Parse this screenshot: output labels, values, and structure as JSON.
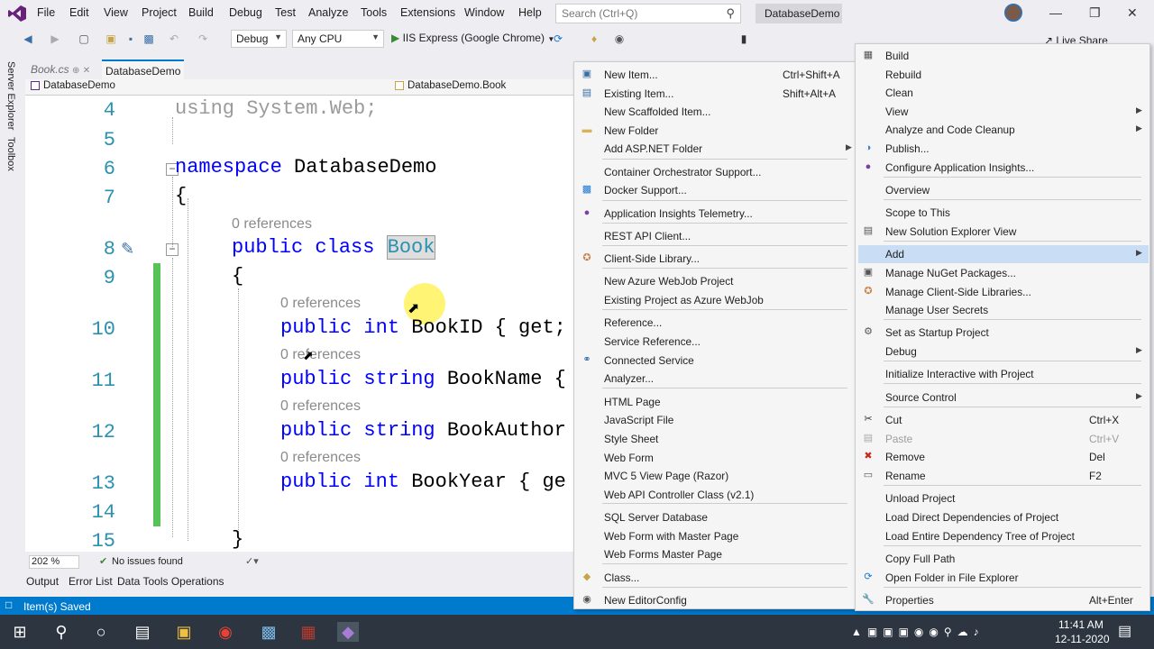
{
  "menubar": {
    "items": [
      "File",
      "Edit",
      "View",
      "Project",
      "Build",
      "Debug",
      "Test",
      "Analyze",
      "Tools",
      "Extensions",
      "Window",
      "Help"
    ],
    "search_placeholder": "Search (Ctrl+Q)",
    "solution_title": "DatabaseDemo"
  },
  "toolbar": {
    "config": "Debug",
    "platform": "Any CPU",
    "run": "IIS Express (Google Chrome)",
    "live_share": "Live Share"
  },
  "leftstrip": {
    "server_explorer": "Server Explorer",
    "toolbox": "Toolbox"
  },
  "tabs": [
    "Book.cs",
    "DatabaseDemo"
  ],
  "nav": {
    "project": "DatabaseDemo",
    "class": "DatabaseDemo.Book"
  },
  "code": {
    "l4": "4",
    "l5": "5",
    "l6": "6",
    "l7": "7",
    "l8": "8",
    "l9": "9",
    "l10": "10",
    "l11": "11",
    "l12": "12",
    "l13": "13",
    "l14": "14",
    "l15": "15",
    "using_kw": "using",
    "using_ns": "System.Web;",
    "ns_kw": "namespace",
    "ns_name": "DatabaseDemo",
    "open_brace": "{",
    "close_brace": "}",
    "refs": "0 references",
    "class_kw": "public class",
    "class_name": "Book",
    "p1_kw": "public int",
    "p1_rest": "BookID { get;",
    "p2_kw": "public string",
    "p2_rest": "BookName {",
    "p3_kw": "public string",
    "p3_rest": "BookAuthor",
    "p4_kw": "public int",
    "p4_rest": "BookYear { ge"
  },
  "editor_status": {
    "zoom": "202 %",
    "issues": "No issues found"
  },
  "bottom_tabs": [
    "Output",
    "Error List",
    "Data Tools Operations"
  ],
  "statusbar": {
    "text": "Item(s) Saved"
  },
  "taskbar": {
    "time": "11:41 AM",
    "date": "12-11-2020"
  },
  "add_menu": [
    {
      "label": "New Item...",
      "shortcut": "Ctrl+Shift+A",
      "icon": "new-item-icon"
    },
    {
      "label": "Existing Item...",
      "shortcut": "Shift+Alt+A",
      "icon": "existing-item-icon"
    },
    {
      "label": "New Scaffolded Item..."
    },
    {
      "label": "New Folder",
      "icon": "folder-icon"
    },
    {
      "label": "Add ASP.NET Folder",
      "submenu": true
    },
    {
      "label": "Container Orchestrator Support..."
    },
    {
      "label": "Docker Support...",
      "icon": "docker-icon"
    },
    {
      "label": "Application Insights Telemetry...",
      "icon": "insights-icon"
    },
    {
      "label": "REST API Client..."
    },
    {
      "label": "Client-Side Library...",
      "icon": "library-icon"
    },
    {
      "label": "New Azure WebJob Project"
    },
    {
      "label": "Existing Project as Azure WebJob"
    },
    {
      "label": "Reference..."
    },
    {
      "label": "Service Reference..."
    },
    {
      "label": "Connected Service",
      "icon": "connected-service-icon"
    },
    {
      "label": "Analyzer..."
    },
    {
      "label": "HTML Page"
    },
    {
      "label": "JavaScript File"
    },
    {
      "label": "Style Sheet"
    },
    {
      "label": "Web Form"
    },
    {
      "label": "MVC 5 View Page (Razor)"
    },
    {
      "label": "Web API Controller Class (v2.1)"
    },
    {
      "label": "SQL Server Database"
    },
    {
      "label": "Web Form with Master Page"
    },
    {
      "label": "Web Forms Master Page"
    },
    {
      "label": "Class...",
      "icon": "class-icon"
    },
    {
      "label": "New EditorConfig",
      "icon": "editorconfig-icon"
    }
  ],
  "project_menu": [
    {
      "label": "Build",
      "icon": "build-icon"
    },
    {
      "label": "Rebuild"
    },
    {
      "label": "Clean"
    },
    {
      "label": "View",
      "submenu": true
    },
    {
      "label": "Analyze and Code Cleanup",
      "submenu": true
    },
    {
      "label": "Publish...",
      "icon": "publish-icon"
    },
    {
      "label": "Configure Application Insights...",
      "icon": "insights-icon"
    },
    {
      "label": "Overview"
    },
    {
      "label": "Scope to This"
    },
    {
      "label": "New Solution Explorer View",
      "icon": "new-view-icon"
    },
    {
      "label": "Add",
      "submenu": true
    },
    {
      "label": "Manage NuGet Packages...",
      "icon": "nuget-icon"
    },
    {
      "label": "Manage Client-Side Libraries...",
      "icon": "library-icon"
    },
    {
      "label": "Manage User Secrets"
    },
    {
      "label": "Set as Startup Project",
      "icon": "gear-icon"
    },
    {
      "label": "Debug",
      "submenu": true
    },
    {
      "label": "Initialize Interactive with Project"
    },
    {
      "label": "Source Control",
      "submenu": true
    },
    {
      "label": "Cut",
      "shortcut": "Ctrl+X",
      "icon": "cut-icon"
    },
    {
      "label": "Paste",
      "shortcut": "Ctrl+V",
      "icon": "paste-icon",
      "disabled": true
    },
    {
      "label": "Remove",
      "shortcut": "Del",
      "icon": "remove-icon"
    },
    {
      "label": "Rename",
      "shortcut": "F2",
      "icon": "rename-icon"
    },
    {
      "label": "Unload Project"
    },
    {
      "label": "Load Direct Dependencies of Project"
    },
    {
      "label": "Load Entire Dependency Tree of Project"
    },
    {
      "label": "Copy Full Path"
    },
    {
      "label": "Open Folder in File Explorer",
      "icon": "refresh-folder-icon"
    },
    {
      "label": "Properties",
      "shortcut": "Alt+Enter",
      "icon": "wrench-icon"
    }
  ]
}
